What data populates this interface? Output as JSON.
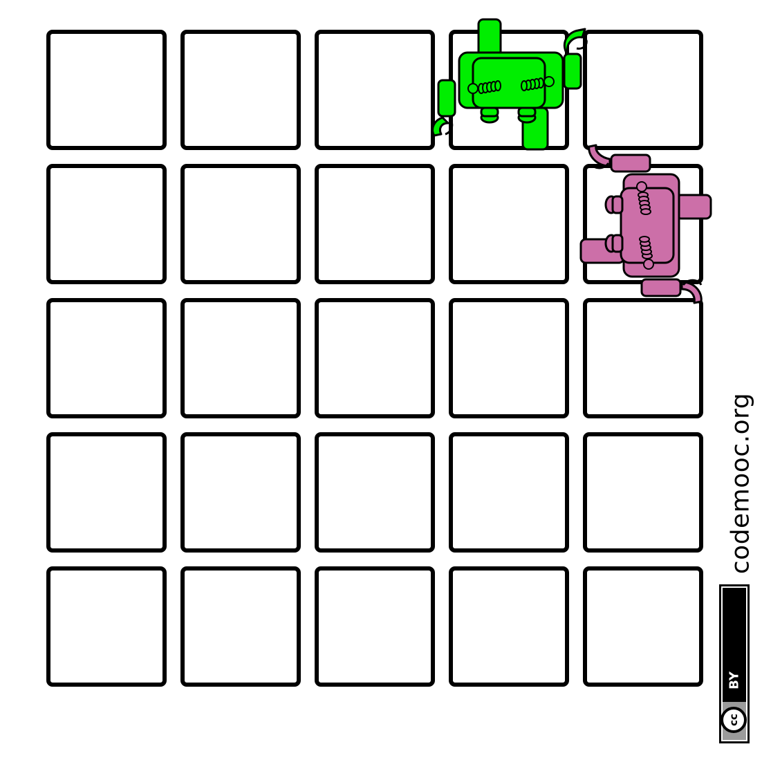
{
  "board": {
    "rows": 5,
    "columns": 5,
    "cell_fill": "#ffffff",
    "cell_border": "#000000"
  },
  "robots": [
    {
      "id": "green-robot",
      "row": 1,
      "column": 4,
      "color": "#00ee00",
      "facing": "down",
      "holding": "none"
    },
    {
      "id": "pink-robot",
      "row": 2,
      "column": 5,
      "color": "#cc6fa8",
      "facing": "left",
      "holding": "none"
    }
  ],
  "footer": {
    "site": "codemooc.org",
    "license_cc": "cc",
    "license_by": "BY"
  }
}
